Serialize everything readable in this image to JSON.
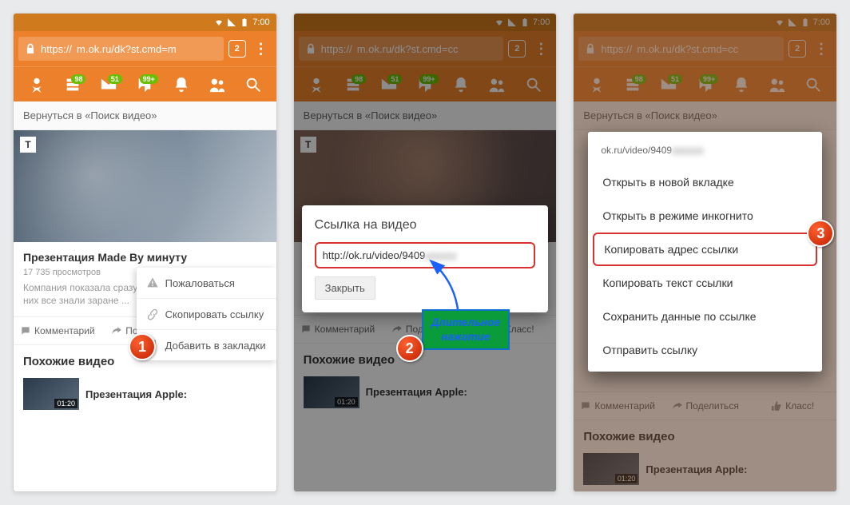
{
  "status": {
    "time": "7:00"
  },
  "browser": {
    "url_prefix": "https://",
    "url_m": "m.ok.ru/dk?st.cmd=m",
    "url_cc": "m.ok.ru/dk?st.cmd=cc",
    "tabs": "2"
  },
  "nav": {
    "b1": "98",
    "b2": "51",
    "b3": "99+",
    "b4": ""
  },
  "back": "Вернуться в «Поиск видео»",
  "video": {
    "title_short": "Презентация Made By минуту",
    "views": "17 735 просмотров",
    "desc": "Компания показала сразу ...\n них все знали заране ...",
    "desc2": "Компания показала сразу несколько новых устройств, но про\nних все знали заранее"
  },
  "ctx": {
    "report": "Пожаловаться",
    "copy": "Скопировать ссылку",
    "bookmark": "Добавить в закладки"
  },
  "actions": {
    "comment": "Комментарий",
    "share": "Поделиться",
    "like": "Класс!"
  },
  "similar": {
    "heading": "Похожие видео",
    "item_title": "Презентация Apple:",
    "dur": "01:20"
  },
  "dialog": {
    "title": "Ссылка на видео",
    "url": "http://ok.ru/video/9409",
    "close": "Закрыть"
  },
  "tooltip": {
    "l1": "Длительное",
    "l2": "нажатие"
  },
  "native": {
    "header": "ok.ru/video/9409",
    "i1": "Открыть в новой вкладке",
    "i2": "Открыть в режиме инкогнито",
    "i3": "Копировать адрес ссылки",
    "i4": "Копировать текст ссылки",
    "i5": "Сохранить данные по ссылке",
    "i6": "Отправить ссылку"
  },
  "badges": {
    "n1": "1",
    "n2": "2",
    "n3": "3"
  }
}
